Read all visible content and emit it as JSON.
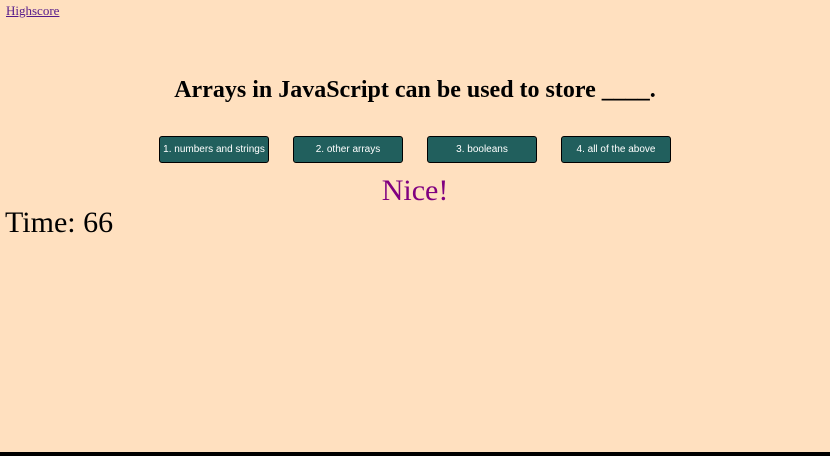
{
  "nav": {
    "highscore_label": "Highscore"
  },
  "quiz": {
    "question": "Arrays in JavaScript can be used to store ____.",
    "answers": [
      "1. numbers and strings",
      "2. other arrays",
      "3. booleans",
      "4. all of the above"
    ],
    "feedback": "Nice!"
  },
  "timer": {
    "text": "Time: 66"
  },
  "colors": {
    "background": "#ffe0bf",
    "button": "#215f5d",
    "feedback": "#800080"
  }
}
